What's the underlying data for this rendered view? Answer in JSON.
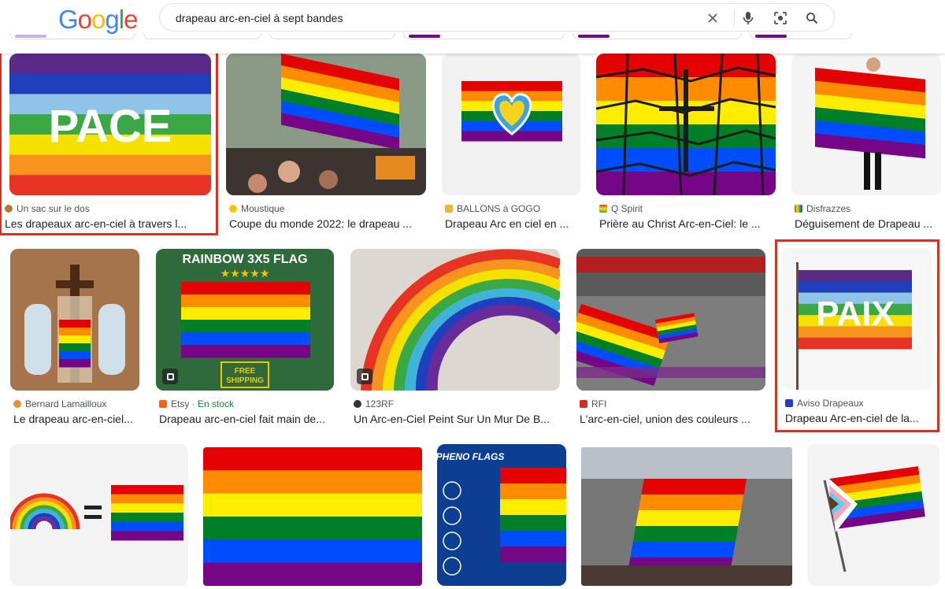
{
  "logo": {
    "letters": [
      "G",
      "o",
      "o",
      "g",
      "l",
      "e"
    ],
    "colors": [
      "#4285F4",
      "#EA4335",
      "#FBBC05",
      "#4285F4",
      "#34A853",
      "#EA4335"
    ]
  },
  "search": {
    "query": "drapeau arc-en-ciel à sept bandes",
    "icons": [
      "clear-icon",
      "microphone-icon",
      "lens-icon",
      "search-icon"
    ]
  },
  "results": [
    {
      "source": "Un sac sur le dos",
      "title": "Les drapeaux arc-en-ciel à travers l...",
      "selected": true,
      "overlay": "PACE"
    },
    {
      "source": "Moustique",
      "title": "Coupe du monde 2022: le drapeau ..."
    },
    {
      "source": "BALLONS à GOGO",
      "title": "Drapeau Arc en ciel en ..."
    },
    {
      "source": "Q Spirit",
      "title": "Prière au Christ Arc-en-Ciel: le ..."
    },
    {
      "source": "Disfrazzes",
      "title": "Déguisement de Drapeau ..."
    },
    {
      "source": "Bernard Lamailloux",
      "title": "Le drapeau arc-en-ciel..."
    },
    {
      "source": "Etsy",
      "stock": "En stock",
      "title": "Drapeau arc-en-ciel fait main de...",
      "overlay": "RAINBOW 3X5 FLAG",
      "overlay2": "FREE SHIPPING"
    },
    {
      "source": "123RF",
      "title": "Un Arc-en-Ciel Peint Sur Un Mur De B..."
    },
    {
      "source": "RFI",
      "title": "L'arc-en-ciel, union des couleurs ..."
    },
    {
      "source": "Aviso Drapeaux",
      "title": "Drapeau Arc-en-ciel de la...",
      "selected": true,
      "overlay": "PAIX"
    },
    {
      "title": ""
    },
    {
      "title": ""
    },
    {
      "title": "",
      "overlay": "PHENO FLAGS"
    },
    {
      "title": ""
    },
    {
      "title": ""
    }
  ],
  "colors": {
    "rainbow6": [
      "#e40303",
      "#ff8c00",
      "#ffed00",
      "#008026",
      "#004dff",
      "#750787"
    ],
    "rainbow7": [
      "#5b2a86",
      "#1f3fbf",
      "#8fc3e8",
      "#3aa845",
      "#f5e100",
      "#f7941d",
      "#e63323"
    ],
    "selection": "#d93025"
  }
}
